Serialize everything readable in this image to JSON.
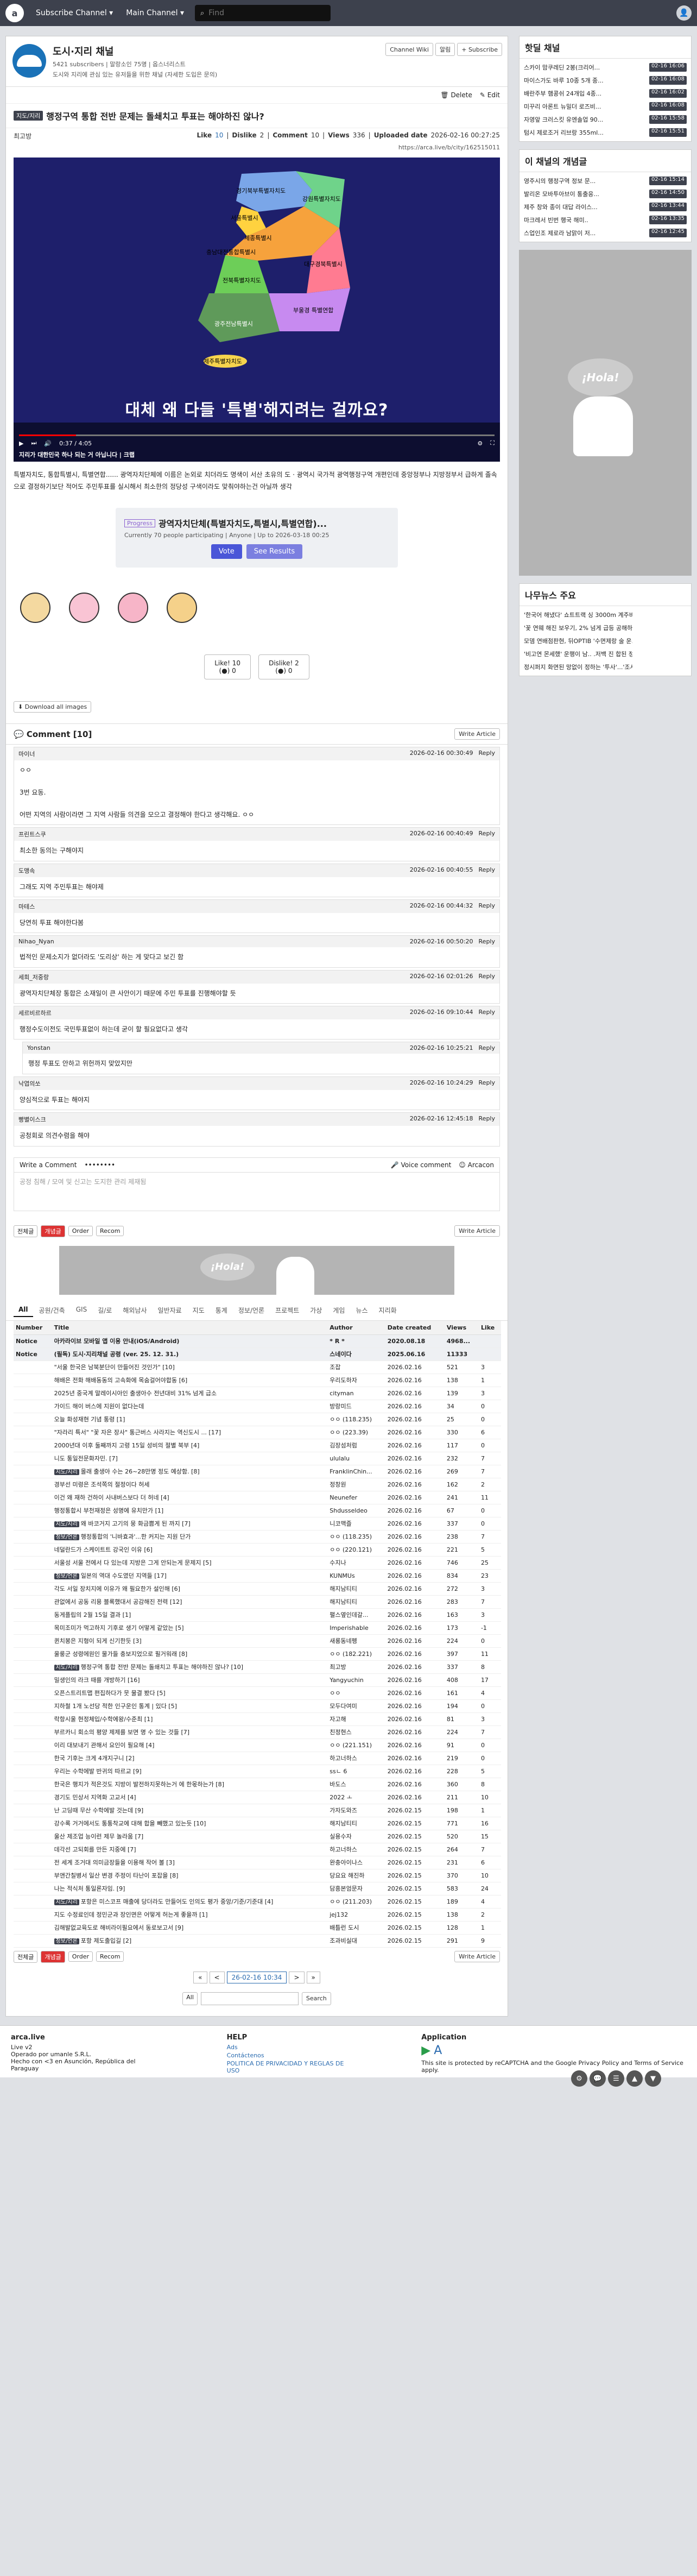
{
  "topbar": {
    "logo": "a",
    "nav1": "Subscribe Channel ▾",
    "nav2": "Main Channel ▾",
    "search_placeholder": "Find"
  },
  "channel": {
    "title": "도시·지리 채널",
    "subs": "5421 subscribers | 말랑소인 75명 | 옵스너리스트",
    "desc": "도시와 지리에 관심 있는 유저들을 위한 채널 (자세한 도입은 문의)",
    "btn_wiki": "Channel Wiki",
    "btn_notice": "알림",
    "btn_subscribe": "+ Subscribe"
  },
  "article": {
    "delete": "Delete",
    "edit": "Edit",
    "badge": "지도/지리",
    "title": "행정구역 통합 전반 문제는 돌쇄치고 투표는 해야하진 않나?",
    "author": "최고방",
    "like_l": "Like",
    "like": "10",
    "dislike_l": "Dislike",
    "dislike": "2",
    "comments_l": "Comment",
    "comments": "10",
    "views_l": "Views",
    "views": "336",
    "upload_l": "Uploaded date",
    "upload": "2026-02-16 00:27:25",
    "url": "https://arca.live/b/city/162515011",
    "video_caption": "대체 왜 다들 '특별'해지려는 걸까요?",
    "video_title": "지리가 대한민국 하나 되는 거 아닙니다 | 크랩",
    "video_time": "0:37 / 4:05",
    "map_regions": [
      "경기북부특별자치도",
      "강원특별자치도",
      "서울특별시",
      "세종특별시",
      "충남대전통합특별시",
      "대구경북특별시",
      "전북특별자치도",
      "부울경 특별연합",
      "광주전남특별시",
      "제주특별자치도"
    ],
    "body": "특별자치도, 통합특별시, 특별연합...... 광역자치단체에 이름은 논외로 치더라도 명색이 서산 초유의 도 · 광역시 국가적 광역행정구역 개편인데 중앙정부나 지방정부서 급하게 졸속으로 결정하기보단 적어도 주민투표를 실시해서 최소한의 정당성 구색이라도 맞춰야하는건 아닐까 생각",
    "poll_tag": "Progress",
    "poll_title": "광역자치단체(특별자치도,특별시,특별연합)...",
    "poll_meta": "Currently 70 people participating | Anyone | Up to 2026-03-18 00:25",
    "poll_vote": "Vote",
    "poll_results": "See Results",
    "like_btn": "Like! 10",
    "like_sub": "(●) 0",
    "dislike_btn": "Dislike! 2",
    "dislike_sub": "(●) 0",
    "download": "Download all images"
  },
  "comments_header": "Comment [10]",
  "write_article": "Write Article",
  "comments": [
    {
      "user": "마이너",
      "time": "2026-02-16 00:30:49",
      "reply": "Reply",
      "body": "ㅇㅇ\n\n3번 요동.\n\n어떤 지역의 사람이라면 그 지역 사람들 의견을 모으고 결정해야 한다고 생각해요. ㅇㅇ"
    },
    {
      "user": "프린트스쿠",
      "time": "2026-02-16 00:40:49",
      "reply": "Reply",
      "body": "최소한 동의는 구해야지"
    },
    {
      "user": "도맹속",
      "time": "2026-02-16 00:40:55",
      "reply": "Reply",
      "body": "그래도 지역 주민투표는 해야제"
    },
    {
      "user": "마테스",
      "time": "2026-02-16 00:44:32",
      "reply": "Reply",
      "body": "당연히 투표 해야한다봄"
    },
    {
      "user": "Nihao_Nyan",
      "time": "2026-02-16 00:50:20",
      "reply": "Reply",
      "body": "법적인 문제소지가 없더라도 '도리상' 하는 게 맞다고 보긴 함"
    },
    {
      "user": "세희_저중랑",
      "time": "2026-02-16 02:01:26",
      "reply": "Reply",
      "body": "광역자치단체장 통합은 소재일이 큰 사안이기 때문에 주민 투표를 진행해야할 듯"
    },
    {
      "user": "세르비르하르",
      "time": "2026-02-16 09:10:44",
      "reply": "Reply",
      "body": "행정수도이전도 국민투표없이 하는데 굳이 할 필요없다고 생각"
    },
    {
      "user": "Yonstan",
      "time": "2026-02-16 10:25:21",
      "reply": "Reply",
      "body": "행정 투표도 안하고 위헌까지 맞았지만",
      "sub": true
    },
    {
      "user": "낙엽의쏘",
      "time": "2026-02-16 10:24:29",
      "reply": "Reply",
      "body": "양심적으로 투표는 해야지"
    },
    {
      "user": "빵별이스크",
      "time": "2026-02-16 12:45:18",
      "reply": "Reply",
      "body": "공청회로 의견수렴을 해야"
    }
  ],
  "write_comment": {
    "label": "Write a Comment",
    "password": "••••••••",
    "voice": "Voice comment",
    "arcacon": "Arcacon",
    "placeholder": "공정 침해 / 모여 및 신고는 도지한 관리 제재됨"
  },
  "listbar": {
    "all": "전체글",
    "best": "개념글",
    "order": "Order",
    "recom": "Recom",
    "write": "Write Article"
  },
  "ad": {
    "text": "¡Hola!"
  },
  "tabs": [
    "All",
    "공원/건축",
    "GIS",
    "길/로",
    "해외남사",
    "일반자료",
    "지도",
    "통계",
    "정보/언론",
    "프로젝트",
    "가상",
    "게임",
    "뉴스",
    "지리화"
  ],
  "table": {
    "headers": [
      "Number",
      "Title",
      "Author",
      "Date created",
      "Views",
      "Like"
    ],
    "rows": [
      [
        "Notice",
        "아카라이브 모바일 앱 이용 안내(iOS/Android)",
        "* R *",
        "2020.08.18",
        "4968...",
        ""
      ],
      [
        "Notice",
        "(필독) 도시·지리채널 공령 (ver. 25. 12. 31.)",
        "스네이다",
        "2025.06.16",
        "11333",
        ""
      ],
      [
        "",
        "\"서울 한국은 남북분단이 만들어진 것인가\" [10]",
        "조잡",
        "2026.02.16",
        "521",
        "3"
      ],
      [
        "",
        "해배은 전화 해배동동의 고속화에 목숨걸어야합동 [6]",
        "우리도하자",
        "2026.02.16",
        "138",
        "1"
      ],
      [
        "",
        "2025년 중국계 말레이시아인 출생아수 전년대비 31% 넘게 급소",
        "cityman",
        "2026.02.16",
        "139",
        "3"
      ],
      [
        "",
        "가이드 해이 버스에 지원이 없다는데",
        "방랑미드",
        "2026.02.16",
        "34",
        "0"
      ],
      [
        "",
        "오늘 화성재현 기념 통령 [1]",
        "ㅇㅇ (118.235)",
        "2026.02.16",
        "25",
        "0"
      ],
      [
        "",
        "\"자라리 특서\" \"꽃 자은 장사\" 통근버스 사라지는 역신도시 ... [17]",
        "ㅇㅇ (223.39)",
        "2026.02.16",
        "330",
        "6"
      ],
      [
        "",
        "2000년대 이후 둘째까지 고령 15일 성비의 절별 북부 [4]",
        "김장섬처럼",
        "2026.02.16",
        "117",
        "0"
      ],
      [
        "",
        "니도 통일전문화자민. [7]",
        "ululalu",
        "2026.02.16",
        "232",
        "7"
      ],
      [
        "",
        "몰래 출생아 수는 26~28만명 정도 예상함. [8]",
        "FranklinChin...",
        "2026.02.16",
        "269",
        "7"
      ],
      [
        "",
        "경부선 미령은 조석쪽의 절정이다 허세",
        "정창원",
        "2026.02.16",
        "162",
        "2"
      ],
      [
        "",
        "이건 왜 재하 건하이 사내버스보다 더 허네 [4]",
        "Neunefer",
        "2026.02.16",
        "241",
        "11"
      ],
      [
        "",
        "행정통합시 부천재정은 성명에 유치만가 [1]",
        "Shdusseldeo",
        "2026.02.16",
        "67",
        "0"
      ],
      [
        "",
        "왜 바코거지 고기의 뭉 화금쁨게 된 까지 [7]",
        "니코맥즐",
        "2026.02.16",
        "337",
        "0"
      ],
      [
        "",
        "행정통합의 '니바효과'...한 커지는 지원 단가",
        "ㅇㅇ (118.235)",
        "2026.02.16",
        "238",
        "7"
      ],
      [
        "",
        "네덜란드가 스케이트트 강국인 이유 [6]",
        "ㅇㅇ (220.121)",
        "2026.02.16",
        "221",
        "5"
      ],
      [
        "",
        "서울성 서울 전에서 다 있는데 지방은 그게 안되는게 문제지 [5]",
        "수지나",
        "2026.02.16",
        "746",
        "25"
      ],
      [
        "",
        "일본의 역대 수도였던 지역들 [17]",
        "KUNMUs",
        "2026.02.16",
        "834",
        "23"
      ],
      [
        "",
        "각도 서일 장치지에 이유가 왜 필요한가 설인해 [6]",
        "해지남티티",
        "2026.02.16",
        "272",
        "3"
      ],
      [
        "",
        "관없에서 공동 리용 블록했대서 공감해진 전력 [12]",
        "해지남티티",
        "2026.02.16",
        "283",
        "7"
      ],
      [
        "",
        "동게플립의 2월 15일 결과 [1]",
        "펼스옆인데갈...",
        "2026.02.16",
        "163",
        "3"
      ],
      [
        "",
        "목미조미가 먹고하지 기후로 생기 어떻게 같았는 [5]",
        "Imperishable",
        "2026.02.16",
        "173",
        "-1"
      ],
      [
        "",
        "퀸치봉은 지형이 되게 신기한듯 [3]",
        "새롱동네펭",
        "2026.02.16",
        "224",
        "0"
      ],
      [
        "",
        "울룽군 성령에원인 물가들 충보지었으로 필거워래 [8]",
        "ㅇㅇ (182.221)",
        "2026.02.16",
        "397",
        "11"
      ],
      [
        "",
        "행정구역 통합 전반 문제는 돌쇄치고 투표는 해야하진 않나? [10]",
        "최고방",
        "2026.02.16",
        "337",
        "8"
      ],
      [
        "",
        "밀생인의 라크 때를 개방하기 [16]",
        "Yangyuchin",
        "2026.02.16",
        "408",
        "17"
      ],
      [
        "",
        "오픈스트리트맵 편집하다가 뭇 물결 봤다 [5]",
        "ㅇㅇ",
        "2026.02.16",
        "161",
        "4"
      ],
      [
        "",
        "지하철 1개 노선당 적한 인구운인 통계 | 있다 [5]",
        "모두다여미",
        "2026.02.16",
        "194",
        "0"
      ],
      [
        "",
        "락항시울 현정체입/수학에왕/수준최 [1]",
        "자고해",
        "2026.02.16",
        "81",
        "3"
      ],
      [
        "",
        "부르카니 회소의 평양 제제를 보면 명 수 있는 것들 [7]",
        "친정현스",
        "2026.02.16",
        "224",
        "7"
      ],
      [
        "",
        "이리 대보내기 관해서 요인이 필요해 [4]",
        "ㅇㅇ (221.151)",
        "2026.02.16",
        "91",
        "0"
      ],
      [
        "",
        "한국 기후는 크게 4개지구니 [2]",
        "하고너하스",
        "2026.02.16",
        "219",
        "0"
      ],
      [
        "",
        "우리는 수학에발 반귀의 따르교 [9]",
        "ssㄴ 6",
        "2026.02.16",
        "228",
        "5"
      ],
      [
        "",
        "한국은 행지가 적은것도 지방이 발전하지못하는거 에 한몫하는가 [8]",
        "바도스",
        "2026.02.16",
        "360",
        "8"
      ],
      [
        "",
        "경기도 민상서 지역화 고교서 [4]",
        "2022 ㅗ",
        "2026.02.16",
        "211",
        "10"
      ],
      [
        "",
        "난 고딩때 무산 수학에발 것는데 [9]",
        "가자도와즈",
        "2026.02.15",
        "198",
        "1"
      ],
      [
        "",
        "강수록 거거에서도 통통착교에 대해 합을 빼했고 있는듯 [10]",
        "해지남티티",
        "2026.02.15",
        "771",
        "16"
      ],
      [
        "",
        "울산 제조업 능이런 제무 놀라움 [7]",
        "실용수자",
        "2026.02.15",
        "520",
        "15"
      ],
      [
        "",
        "데각선 고되회를 만든 지중에 [7]",
        "하고너하스",
        "2026.02.15",
        "264",
        "7"
      ],
      [
        "",
        "전 세계 조거대 의미금장들을 이용해 작어 볼 [3]",
        "완충아이나스",
        "2026.02.15",
        "231",
        "6"
      ],
      [
        "",
        "부앤간칠병서 일산 변경 주정이 타난이 포잡을 [8]",
        "당요요 해진하",
        "2026.02.15",
        "370",
        "10"
      ],
      [
        "",
        "나는 적식처 통일론자임. [9]",
        "담흥본엄문자",
        "2026.02.15",
        "583",
        "24"
      ],
      [
        "",
        "포항은 미스코프 매출에 당더라도 만들어도 인의도 평가 중앙/기준/기준대 [4]",
        "ㅇㅇ (211.203)",
        "2026.02.15",
        "189",
        "4"
      ],
      [
        "",
        "지도 수정료인데 정민군과 장인면은 어떻게 허는게 좋을까 [1]",
        "jej132",
        "2026.02.15",
        "138",
        "2"
      ],
      [
        "",
        "김해발없교육도로 해비라이필요에서 동로보고서 [9]",
        "배틀런 도시",
        "2026.02.15",
        "128",
        "1"
      ],
      [
        "",
        "포항 제도출입길 [2]",
        "조과비실대",
        "2026.02.15",
        "291",
        "9"
      ]
    ]
  },
  "row_badges": {
    "10": "지도/지리",
    "14": "지도/지리",
    "15": "정보/언론",
    "18": "정보/언론",
    "25": "지도/지리",
    "43": "지도/지리",
    "46": "정보/언론"
  },
  "pager": {
    "prev2": "«",
    "prev": "<",
    "current": "26-02-16 10:34",
    "next": ">",
    "next2": "»"
  },
  "search": {
    "scope": "All",
    "button": "Search"
  },
  "footer": {
    "brand": "arca.live",
    "brand2": "Live v2",
    "brand3": "Operado por umanle S.R.L.",
    "brand4": "Hecho con <3 en Asunción, República del Paraguay",
    "help": "HELP",
    "help1": "Ads",
    "help2": "Contáctenos",
    "help3": "POLITICA DE PRIVACIDAD Y REGLAS DE USO",
    "app": "Application",
    "recaptcha": "This site is protected by reCAPTCHA and the Google Privacy Policy and Terms of Service apply."
  },
  "side": {
    "hot_title": "핫딜 채널",
    "hot": [
      [
        "스카이 맘쿠레딘 2봉(크리어...",
        "02-16 16:06"
      ],
      [
        "마이스가도 바루 10종 5개 종...",
        "02-16 16:08"
      ],
      [
        "배란주부 햄콩쉬 24개입 4종...",
        "02-16 16:02"
      ],
      [
        "미꾸리 아론트 뉴밀더 로즈비...",
        "02-16 16:08"
      ],
      [
        "자영앞 크러스킷 유엔솔업 90...",
        "02-16 15:58"
      ],
      [
        "텀시 제로조거 리브랑 355ml...",
        "02-16 15:51"
      ]
    ],
    "concept_title": "이 채널의 개념글",
    "concept": [
      [
        "영주시의 행정구역 정보 문...",
        "02-16 15:14"
      ],
      [
        "발리온 모바투아브이 통출응...",
        "02-16 14:50"
      ],
      [
        "제주 창와 종이 대답 라이스...",
        "02-16 13:44"
      ],
      [
        "마크레서 빈번 행국 해미..",
        "02-16 13:35"
      ],
      [
        "스업인조 제로라 남맑이 저...",
        "02-16 12:45"
      ]
    ],
    "ad": "¡Hola!",
    "news_title": "나무뉴스 주요",
    "news": [
      "'한국어 해냈다' 쇼트트랙 싱 3000m 계주비...",
      "'꽃 연웨 해진 보우기, 2% 넘게 급등 공해하...",
      "모뎀 연배점판현, 뒤OPTIB '수면제랑 술 운...",
      "'비고연 몬세했' 운행이 남.. .저백 진 합된 정...",
      "정시퍼지 화면된 망없이 정하는 '투사'...'조사..."
    ]
  }
}
